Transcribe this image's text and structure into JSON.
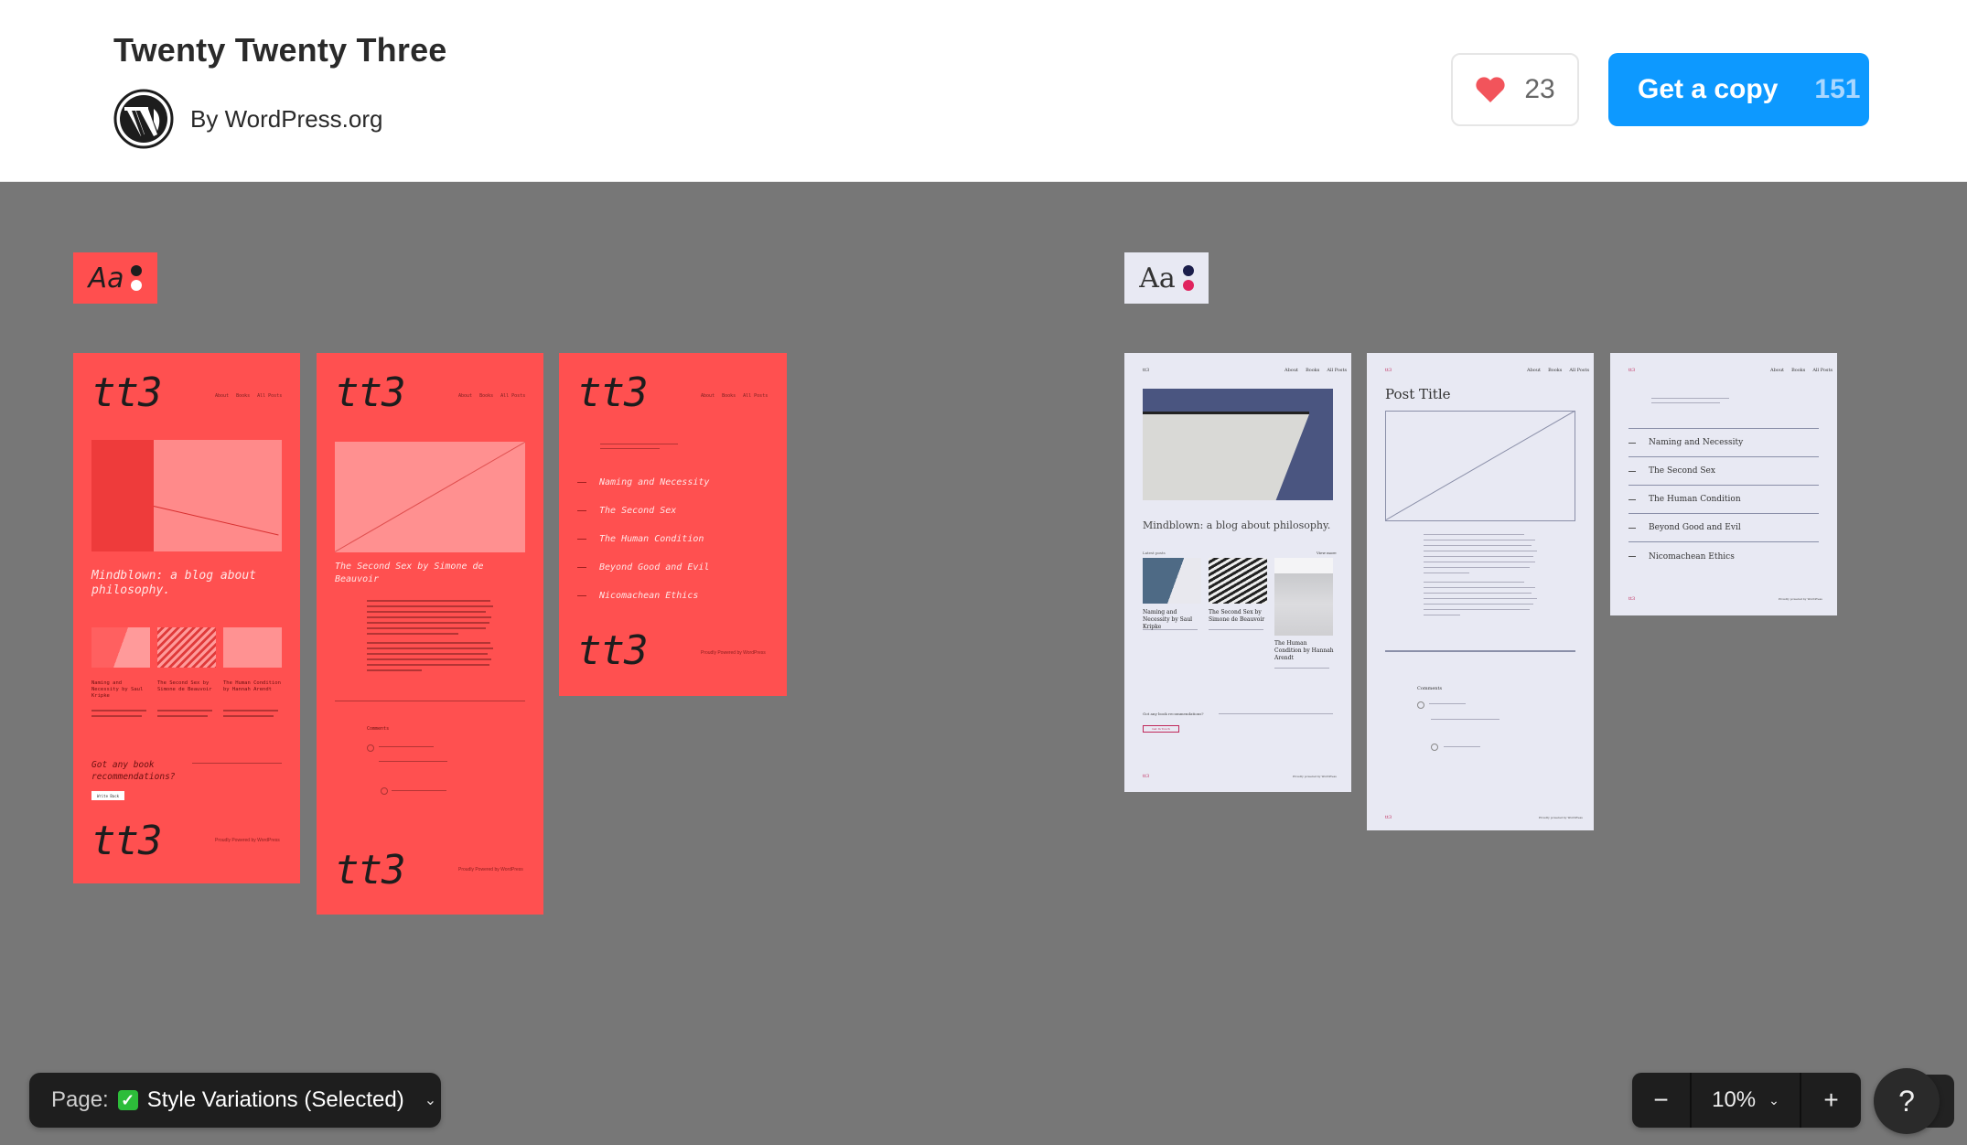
{
  "header": {
    "title": "Twenty Twenty Three",
    "author": "By WordPress.org",
    "author_icon": "wordpress-logo-icon",
    "like_icon": "heart-icon",
    "like_count": "23",
    "copy_label": "Get a copy",
    "copy_count": "151"
  },
  "colors": {
    "accent_blue": "#0d99ff",
    "red_variation": "#ff5050",
    "light_variation": "#e8e9f3",
    "canvas": "#777777",
    "heart": "#f2545b"
  },
  "variations": [
    {
      "name": "red",
      "chip": {
        "aa": "Aa",
        "dot_colors": [
          "#1e1e1e",
          "#ffffff"
        ]
      },
      "frames": [
        {
          "type": "home",
          "logo": "tt3",
          "nav": [
            "About",
            "Books",
            "All Posts"
          ],
          "headline": "Mindblown: a blog about philosophy.",
          "posts": [
            "Naming and Necessity by Saul Kripke",
            "The Second Sex by Simone de Beauvoir",
            "The Human Condition by Hannah Arendt"
          ],
          "cta": "Got any book recommendations?",
          "cta_button": "Write Back",
          "footer_logo": "tt3",
          "footer_text": "Proudly Powered by WordPress"
        },
        {
          "type": "post",
          "logo": "tt3",
          "nav": [
            "About",
            "Books",
            "All Posts"
          ],
          "post_title": "The Second Sex by Simone de Beauvoir",
          "comments_heading": "Comments",
          "footer_logo": "tt3",
          "footer_text": "Proudly Powered by WordPress"
        },
        {
          "type": "archive",
          "logo": "tt3",
          "nav": [
            "About",
            "Books",
            "All Posts"
          ],
          "items": [
            "Naming and Necessity",
            "The Second Sex",
            "The Human Condition",
            "Beyond Good and Evil",
            "Nicomachean Ethics"
          ],
          "footer_logo": "tt3",
          "footer_text": "Proudly Powered by WordPress"
        }
      ]
    },
    {
      "name": "light",
      "chip": {
        "aa": "Aa",
        "dot_colors": [
          "#1b1e4b",
          "#e0245e"
        ]
      },
      "frames": [
        {
          "type": "home",
          "logo": "tt3",
          "nav": [
            "About",
            "Books",
            "All Posts"
          ],
          "headline": "Mindblown: a blog about philosophy.",
          "section_left": "Latest posts",
          "section_right": "View more",
          "posts": [
            "Naming and Necessity by Saul Kripke",
            "The Second Sex by Simone de Beauvoir",
            "The Human Condition by Hannah Arendt"
          ],
          "cta": "Got any book recommendations?",
          "cta_button": "Get In Touch",
          "footer_text": "Proudly powered by WordPress"
        },
        {
          "type": "post",
          "logo": "tt3",
          "nav": [
            "About",
            "Books",
            "All Posts"
          ],
          "post_title": "Post Title",
          "comments_heading": "Comments",
          "footer_text": "Proudly powered by WordPress"
        },
        {
          "type": "archive",
          "logo": "tt3",
          "nav": [
            "About",
            "Books",
            "All Posts"
          ],
          "items": [
            "Naming and Necessity",
            "The Second Sex",
            "The Human Condition",
            "Beyond Good and Evil",
            "Nicomachean Ethics"
          ],
          "footer_text": "Proudly powered by WordPress"
        }
      ]
    }
  ],
  "bottom_bar": {
    "page_label": "Page:",
    "page_icon": "check-mark-icon",
    "page_value": "Style Variations (Selected)",
    "zoom_out": "−",
    "zoom_level": "10%",
    "zoom_in": "+",
    "help": "?"
  }
}
